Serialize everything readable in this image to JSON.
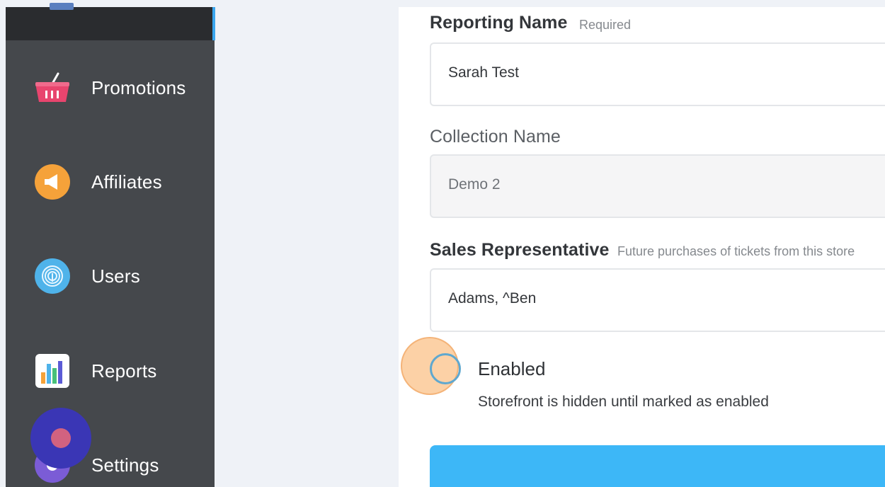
{
  "sidebar": {
    "items": [
      {
        "label": "Promotions",
        "icon": "basket-icon"
      },
      {
        "label": "Affiliates",
        "icon": "megaphone-icon"
      },
      {
        "label": "Users",
        "icon": "fingerprint-icon"
      },
      {
        "label": "Reports",
        "icon": "bar-chart-icon"
      },
      {
        "label": "Settings",
        "icon": "gear-icon"
      }
    ]
  },
  "form": {
    "reporting_name": {
      "label": "Reporting Name",
      "hint": "Required",
      "value": "Sarah Test"
    },
    "collection_name": {
      "label": "Collection Name",
      "value": "Demo 2"
    },
    "sales_rep": {
      "label": "Sales Representative",
      "hint": "Future purchases of tickets from this store",
      "value": "Adams, ^Ben"
    },
    "enabled": {
      "label": "Enabled",
      "help": "Storefront is hidden until marked as enabled",
      "checked": false
    }
  },
  "colors": {
    "sidebar_bg": "#45484c",
    "sidebar_active": "#2a2c2f",
    "accent": "#3aa6ee",
    "primary_button": "#3db7f7"
  }
}
